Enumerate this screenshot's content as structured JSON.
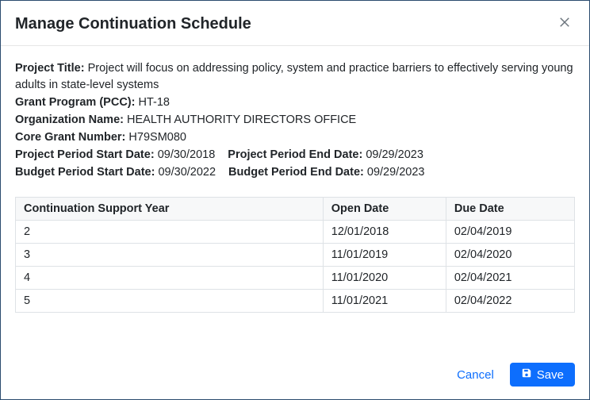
{
  "header": {
    "title": "Manage Continuation Schedule"
  },
  "meta": {
    "project_title_label": "Project Title:",
    "project_title_value": "Project will focus on addressing policy, system and practice barriers to effectively serving young adults in state-level systems",
    "grant_program_label": "Grant Program (PCC):",
    "grant_program_value": "HT-18",
    "org_name_label": "Organization Name:",
    "org_name_value": "HEALTH AUTHORITY DIRECTORS OFFICE",
    "core_grant_label": "Core Grant Number:",
    "core_grant_value": "H79SM080",
    "pp_start_label": "Project Period Start Date:",
    "pp_start_value": "09/30/2018",
    "pp_end_label": "Project Period End Date:",
    "pp_end_value": "09/29/2023",
    "bp_start_label": "Budget Period Start Date:",
    "bp_start_value": "09/30/2022",
    "bp_end_label": "Budget Period End Date:",
    "bp_end_value": "09/29/2023"
  },
  "table": {
    "headers": {
      "year": "Continuation Support Year",
      "open": "Open Date",
      "due": "Due Date"
    },
    "rows": [
      {
        "year": "2",
        "open": "12/01/2018",
        "due": "02/04/2019"
      },
      {
        "year": "3",
        "open": "11/01/2019",
        "due": "02/04/2020"
      },
      {
        "year": "4",
        "open": "11/01/2020",
        "due": "02/04/2021"
      },
      {
        "year": "5",
        "open": "11/01/2021",
        "due": "02/04/2022"
      }
    ]
  },
  "footer": {
    "cancel": "Cancel",
    "save": "Save"
  }
}
